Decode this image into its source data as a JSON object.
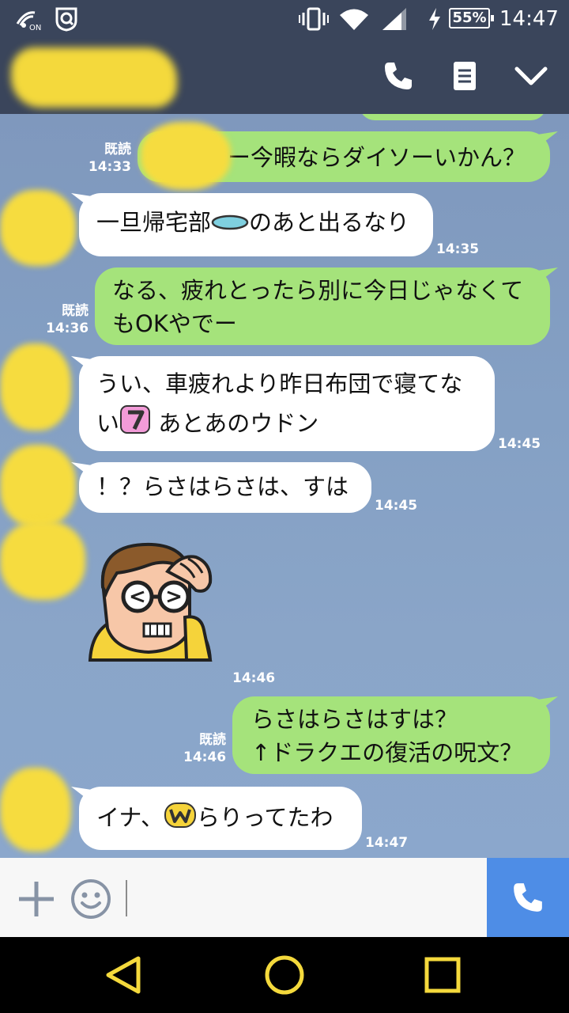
{
  "status_bar": {
    "nfc_badge": "ON",
    "battery": "55%",
    "time": "14:47",
    "icons": [
      "nfc-icon",
      "shield-app-icon",
      "vibrate-icon",
      "wifi-icon",
      "signal-icon",
      "charging-icon"
    ]
  },
  "header": {
    "icons": [
      "phone-icon",
      "note-icon",
      "chevron-down-icon"
    ]
  },
  "messages": [
    {
      "side": "out",
      "text": "ー今暇ならダイソーいかん？",
      "read": "既読",
      "time": "14:33"
    },
    {
      "side": "in",
      "text_before": "一旦帰宅部",
      "emoji": "pill-emoji",
      "text_after": "のあと出るなり",
      "time": "14:35"
    },
    {
      "side": "out",
      "text": "なる、疲れとったら別に今日じゃなくてもOKやでー",
      "read": "既読",
      "time": "14:36"
    },
    {
      "side": "in",
      "text_before": "うい、車疲れより昨日布団で寝てない",
      "emoji": "seven-emoji",
      "text_after": "あとあのウドン",
      "time": "14:45"
    },
    {
      "side": "in",
      "text": "！？らさはらさは、すは",
      "time": "14:45"
    },
    {
      "side": "in",
      "sticker": "headache-man-sticker",
      "time": "14:46"
    },
    {
      "side": "out",
      "line1": "らさはらさはすは？",
      "line2": "↑ドラクエの復活の呪文？",
      "read": "既読",
      "time": "14:46"
    },
    {
      "side": "in",
      "text_before": "イナ、",
      "emoji": "w-emoji",
      "text_after": "らりってたわ",
      "time": "14:47"
    }
  ],
  "input_bar": {
    "icons": [
      "plus-icon",
      "smiley-icon",
      "call-icon"
    ]
  },
  "nav_bar": {
    "icons": [
      "back-icon",
      "home-icon",
      "recents-icon"
    ]
  },
  "colors": {
    "header": "#3a455b",
    "outgoing_bubble": "#a5e37b",
    "incoming_bubble": "#ffffff",
    "chat_background": "#84a0c4",
    "call_button": "#4e8de6",
    "nav_icons": "#f4d93c"
  }
}
